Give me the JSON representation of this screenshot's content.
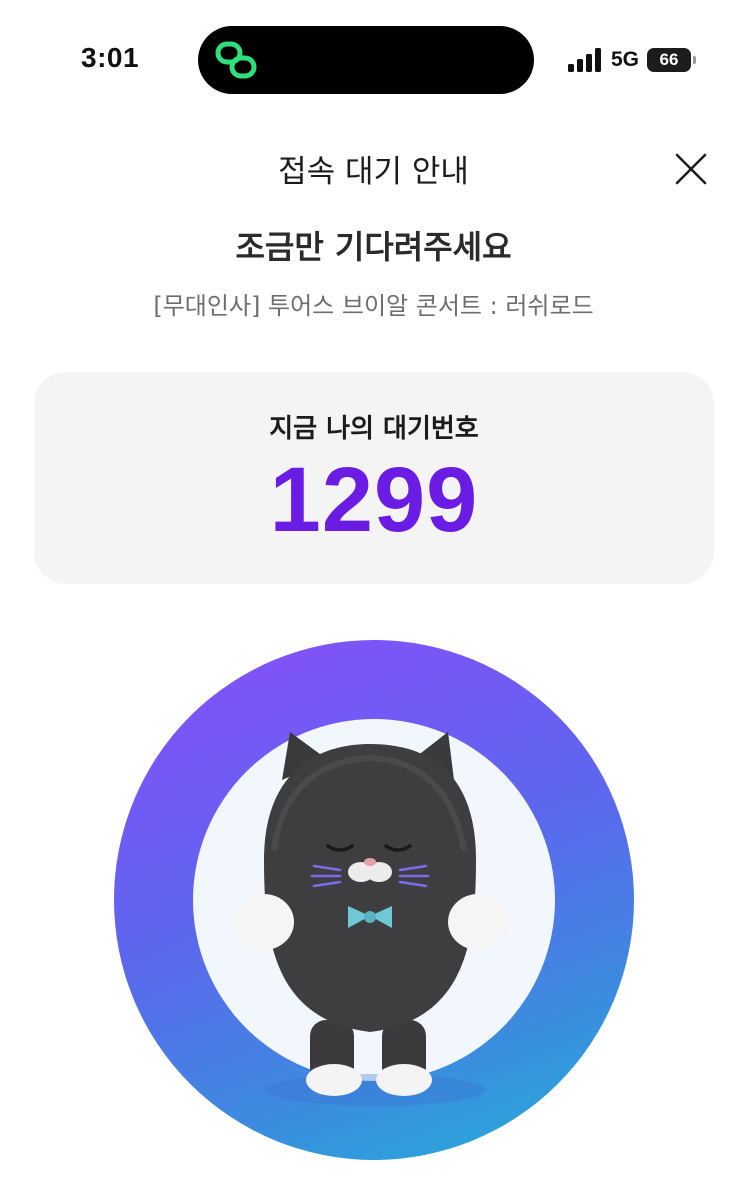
{
  "status_bar": {
    "time": "3:01",
    "network": "5G",
    "battery": "66"
  },
  "header": {
    "title": "접속 대기 안내",
    "close_icon": "close-icon"
  },
  "main": {
    "heading": "조금만 기다려주세요",
    "event_name": "[무대인사] 투어스 브이알 콘서트 : 러쉬로드"
  },
  "queue": {
    "label": "지금 나의 대기번호",
    "number": "1299",
    "number_color": "#6a1be4"
  },
  "illustration": {
    "icon": "cat-character-illustration",
    "ring_colors": [
      "#8a4dfc",
      "#5d66ee",
      "#3c8bdf",
      "#22b0d8"
    ]
  }
}
